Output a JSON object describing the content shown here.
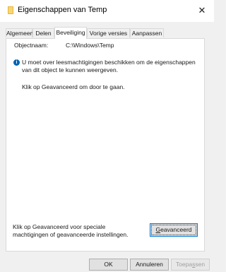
{
  "window": {
    "title": "Eigenschappen van Temp",
    "close_glyph": "✕",
    "icon": "folder-icon"
  },
  "tabs": [
    {
      "label": "Algemeen",
      "active": false
    },
    {
      "label": "Delen",
      "active": false
    },
    {
      "label": "Beveiliging",
      "active": true
    },
    {
      "label": "Vorige versies",
      "active": false
    },
    {
      "label": "Aanpassen",
      "active": false
    }
  ],
  "security": {
    "object_label": "Objectnaam:",
    "object_value": "C:\\Windows\\Temp",
    "info_icon": "info-icon",
    "info_text": "U moet over leesmachtigingen beschikken om de eigenschappen van dit object te kunnen weergeven.",
    "hint": "Klik op Geavanceerd om door te gaan.",
    "advanced_desc": "Klik op Geavanceerd voor speciale machtigingen of geavanceerde instellingen.",
    "advanced_button": {
      "accel": "G",
      "rest": "eavanceerd"
    }
  },
  "footer": {
    "ok": "OK",
    "cancel": "Annuleren",
    "apply": {
      "pre": "Toepa",
      "accel": "s",
      "post": "sen"
    }
  },
  "colors": {
    "accent": "#0078d7",
    "info": "#0063b1",
    "folder": "#f2c94c"
  }
}
